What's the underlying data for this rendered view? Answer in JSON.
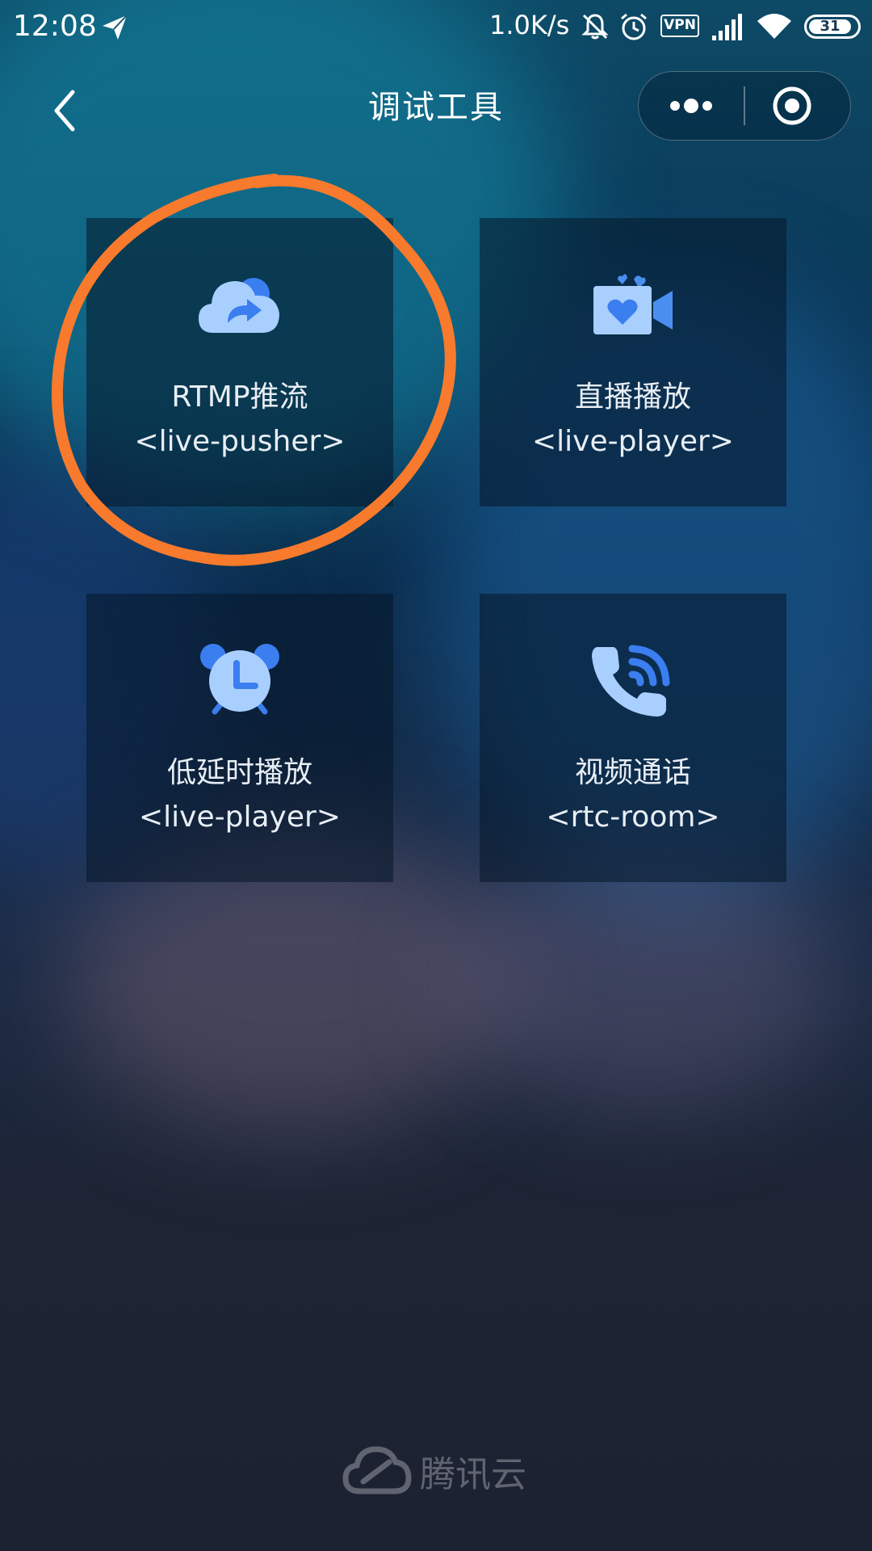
{
  "status": {
    "time": "12:08",
    "network_speed": "1.0K/s",
    "vpn_label": "VPN",
    "battery": "31",
    "icons": [
      "send-icon",
      "mute-icon",
      "alarm-icon",
      "vpn-icon",
      "signal-icon",
      "wifi-icon",
      "battery-icon"
    ]
  },
  "nav": {
    "title": "调试工具",
    "back_icon": "chevron-left-icon",
    "more_icon": "more-dots-icon",
    "close_icon": "target-circle-icon"
  },
  "cards": [
    {
      "title": "RTMP推流",
      "subtitle": "<live-pusher>",
      "icon": "cloud-share-icon"
    },
    {
      "title": "直播播放",
      "subtitle": "<live-player>",
      "icon": "video-camera-heart-icon"
    },
    {
      "title": "低延时播放",
      "subtitle": "<live-player>",
      "icon": "alarm-clock-icon"
    },
    {
      "title": "视频通话",
      "subtitle": "<rtc-room>",
      "icon": "phone-call-icon"
    }
  ],
  "footer": {
    "brand": "腾讯云",
    "logo_icon": "tencent-cloud-logo-icon"
  },
  "colors": {
    "icon_blue": "#4a8ff0",
    "icon_light": "#a9cfff",
    "annotation_orange": "#f87a2c"
  }
}
